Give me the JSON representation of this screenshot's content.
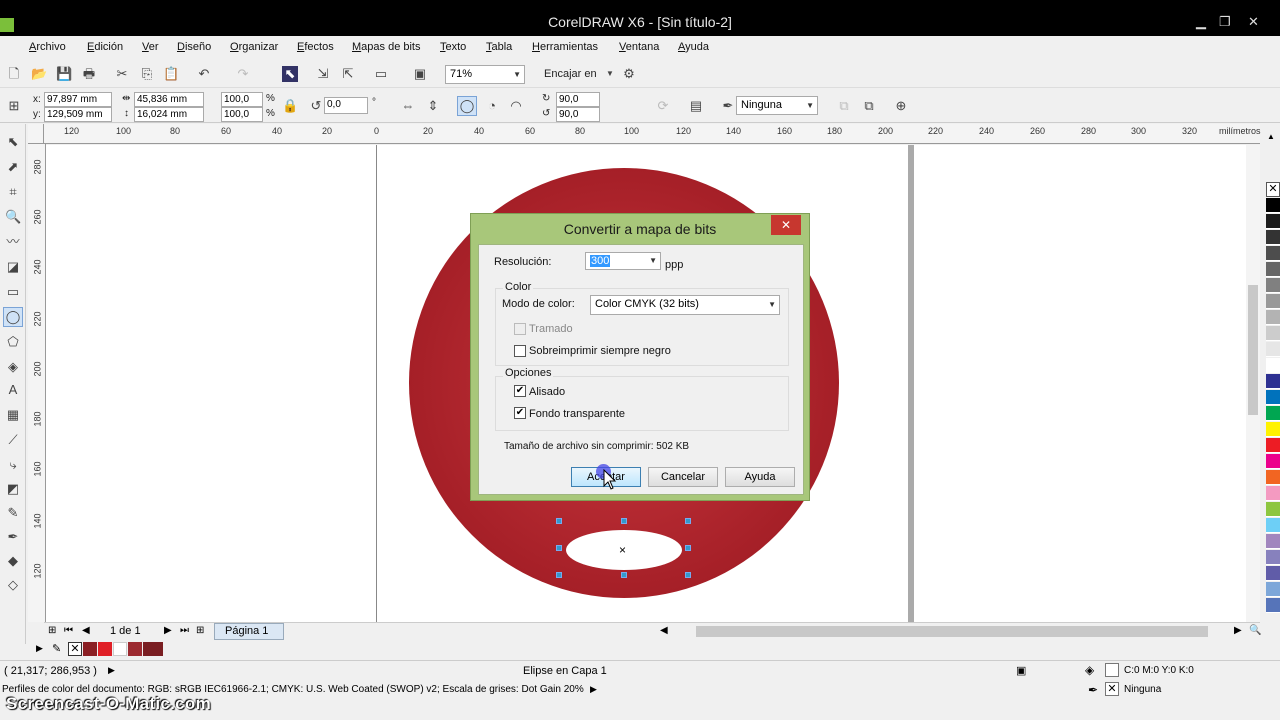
{
  "window": {
    "title": "CorelDRAW X6 - [Sin título-2]"
  },
  "menu": [
    "Archivo",
    "Edición",
    "Ver",
    "Diseño",
    "Organizar",
    "Efectos",
    "Mapas de bits",
    "Texto",
    "Tabla",
    "Herramientas",
    "Ventana",
    "Ayuda"
  ],
  "toolbar": {
    "zoom": "71%",
    "snap": "Encajar en"
  },
  "props": {
    "x": "97,897 mm",
    "y": "129,509 mm",
    "w": "45,836 mm",
    "h": "16,024 mm",
    "sx": "100,0",
    "sy": "100,0",
    "pct": "%",
    "rot": "0,0",
    "deg": "°",
    "a1": "90,0",
    "a2": "90,0",
    "outline": "Ninguna"
  },
  "ruler": {
    "h_ticks": [
      "120",
      "100",
      "80",
      "60",
      "40",
      "20",
      "0",
      "20",
      "40",
      "60",
      "80",
      "100",
      "120",
      "140",
      "160",
      "180",
      "200",
      "220",
      "240",
      "260",
      "280",
      "300",
      "320"
    ],
    "unit": "milímetros",
    "v_ticks": [
      "280",
      "260",
      "240",
      "220",
      "200",
      "180",
      "160",
      "140",
      "120"
    ]
  },
  "dialog": {
    "title": "Convertir a mapa de bits",
    "close": "✕",
    "resolution_label": "Resolución:",
    "resolution_value": "300",
    "resolution_unit": "ppp",
    "color_group": "Color",
    "color_mode_label": "Modo de color:",
    "color_mode_value": "Color CMYK (32 bits)",
    "dither_label": "Tramado",
    "overprint_label": "Sobreimprimir siempre negro",
    "options_group": "Opciones",
    "antialias_label": "Alisado",
    "transparent_label": "Fondo transparente",
    "size_label": "Tamaño de archivo sin comprimir: 502 KB",
    "ok": "Aceptar",
    "cancel": "Cancelar",
    "help": "Ayuda"
  },
  "page": {
    "count": "1 de 1",
    "tab": "Página 1"
  },
  "status": {
    "coords": "( 21,317; 286,953 )",
    "object": "Elipse en Capa 1",
    "fill": "C:0 M:0 Y:0 K:0",
    "outline": "Ninguna",
    "profiles": "Perfiles de color del documento: RGB: sRGB IEC61966-2.1; CMYK: U.S. Web Coated (SWOP) v2; Escala de grises: Dot Gain 20%"
  },
  "watermark": "Screencast-O-Matic.com",
  "colors": {
    "circle": "#b3262d",
    "accent": "#a8c77a"
  }
}
